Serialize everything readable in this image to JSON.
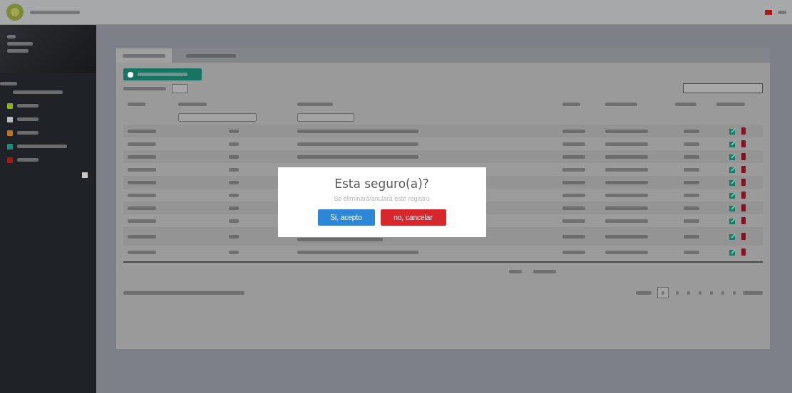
{
  "sidebar": {
    "items": [
      {
        "kind": "sub"
      },
      {
        "kind": "icon",
        "color": "#8fae1b"
      },
      {
        "kind": "icon",
        "color": "#b8bcc2"
      },
      {
        "kind": "icon",
        "color": "#b8741f"
      },
      {
        "kind": "icon",
        "color": "#1f8a7a"
      },
      {
        "kind": "icon",
        "color": "#a01818"
      }
    ]
  },
  "rows": [
    {
      "kind": "single"
    },
    {
      "kind": "single"
    },
    {
      "kind": "single"
    },
    {
      "kind": "single"
    },
    {
      "kind": "single"
    },
    {
      "kind": "single"
    },
    {
      "kind": "single"
    },
    {
      "kind": "single"
    },
    {
      "kind": "double"
    },
    {
      "kind": "single"
    }
  ],
  "pagination": {
    "pages": [
      {
        "selected": true
      },
      {
        "selected": false
      },
      {
        "selected": false
      },
      {
        "selected": false
      },
      {
        "selected": false
      },
      {
        "selected": false
      },
      {
        "selected": false
      }
    ]
  },
  "dialog": {
    "title": "Esta seguro(a)?",
    "message": "Se eliminará/anulará este registro",
    "confirm": "Si, acepto",
    "cancel": "no, cancelar"
  }
}
